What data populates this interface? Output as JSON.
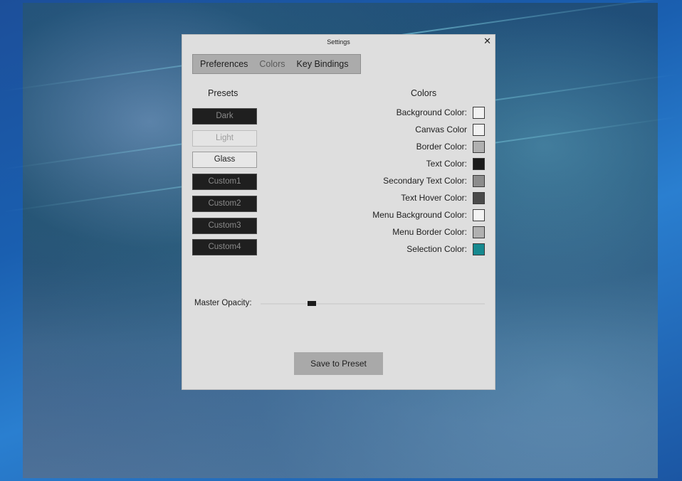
{
  "window": {
    "title": "Settings",
    "close_glyph": "✕"
  },
  "tabs": [
    {
      "label": "Preferences",
      "active": false
    },
    {
      "label": "Colors",
      "active": true
    },
    {
      "label": "Key Bindings",
      "active": false
    }
  ],
  "presets": {
    "heading": "Presets",
    "items": [
      {
        "label": "Dark",
        "style": "dark"
      },
      {
        "label": "Light",
        "style": "light"
      },
      {
        "label": "Glass",
        "style": "glass"
      },
      {
        "label": "Custom1",
        "style": "dark"
      },
      {
        "label": "Custom2",
        "style": "dark"
      },
      {
        "label": "Custom3",
        "style": "dark"
      },
      {
        "label": "Custom4",
        "style": "dark"
      }
    ]
  },
  "colors": {
    "heading": "Colors",
    "items": [
      {
        "label": "Background Color:",
        "value": "#f2f2f2"
      },
      {
        "label": "Canvas Color",
        "value": "#f2f2f2"
      },
      {
        "label": "Border Color:",
        "value": "#b0b0b0"
      },
      {
        "label": "Text Color:",
        "value": "#1b1b1b"
      },
      {
        "label": "Secondary Text Color:",
        "value": "#8c8c8c"
      },
      {
        "label": "Text Hover Color:",
        "value": "#4a4a4a"
      },
      {
        "label": "Menu Background Color:",
        "value": "#f4f4f4"
      },
      {
        "label": "Menu Border Color:",
        "value": "#b0b0b0"
      },
      {
        "label": "Selection Color:",
        "value": "#16898f"
      }
    ]
  },
  "opacity": {
    "label": "Master Opacity:",
    "value_fraction": 0.23
  },
  "save_button": {
    "label": "Save to Preset"
  }
}
